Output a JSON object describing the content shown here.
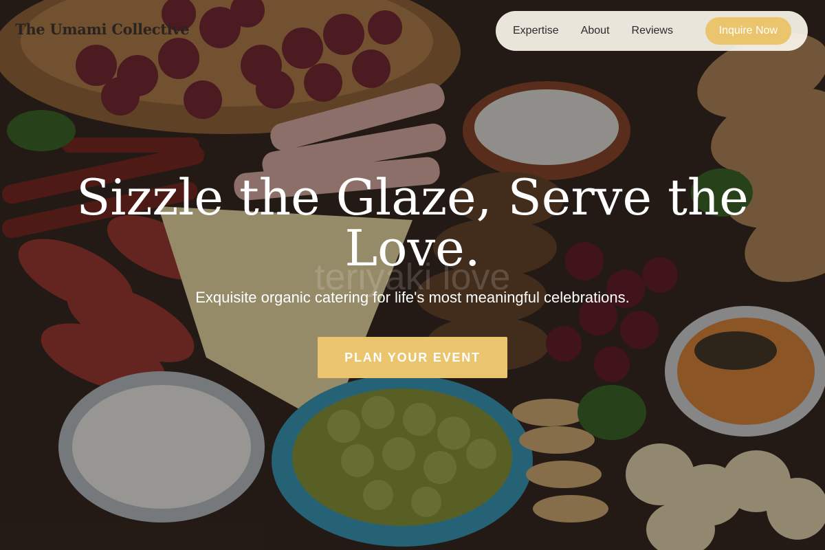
{
  "brand": {
    "name": "The Umami Collective"
  },
  "nav": {
    "links": [
      "Expertise",
      "About",
      "Reviews"
    ],
    "cta": "Inquire Now"
  },
  "hero": {
    "headline": "Sizzle the Glaze, Serve the Love.",
    "ghost_text": "teriyaki love",
    "subtitle": "Exquisite organic catering for life's most meaningful celebrations.",
    "button": "PLAN YOUR EVENT",
    "background_image": "charcuterie-board-photo"
  },
  "colors": {
    "accent": "#ebc46e",
    "nav_background": "#faf5eb",
    "text_light": "#ffffff",
    "text_dark": "#2b2b2b"
  }
}
